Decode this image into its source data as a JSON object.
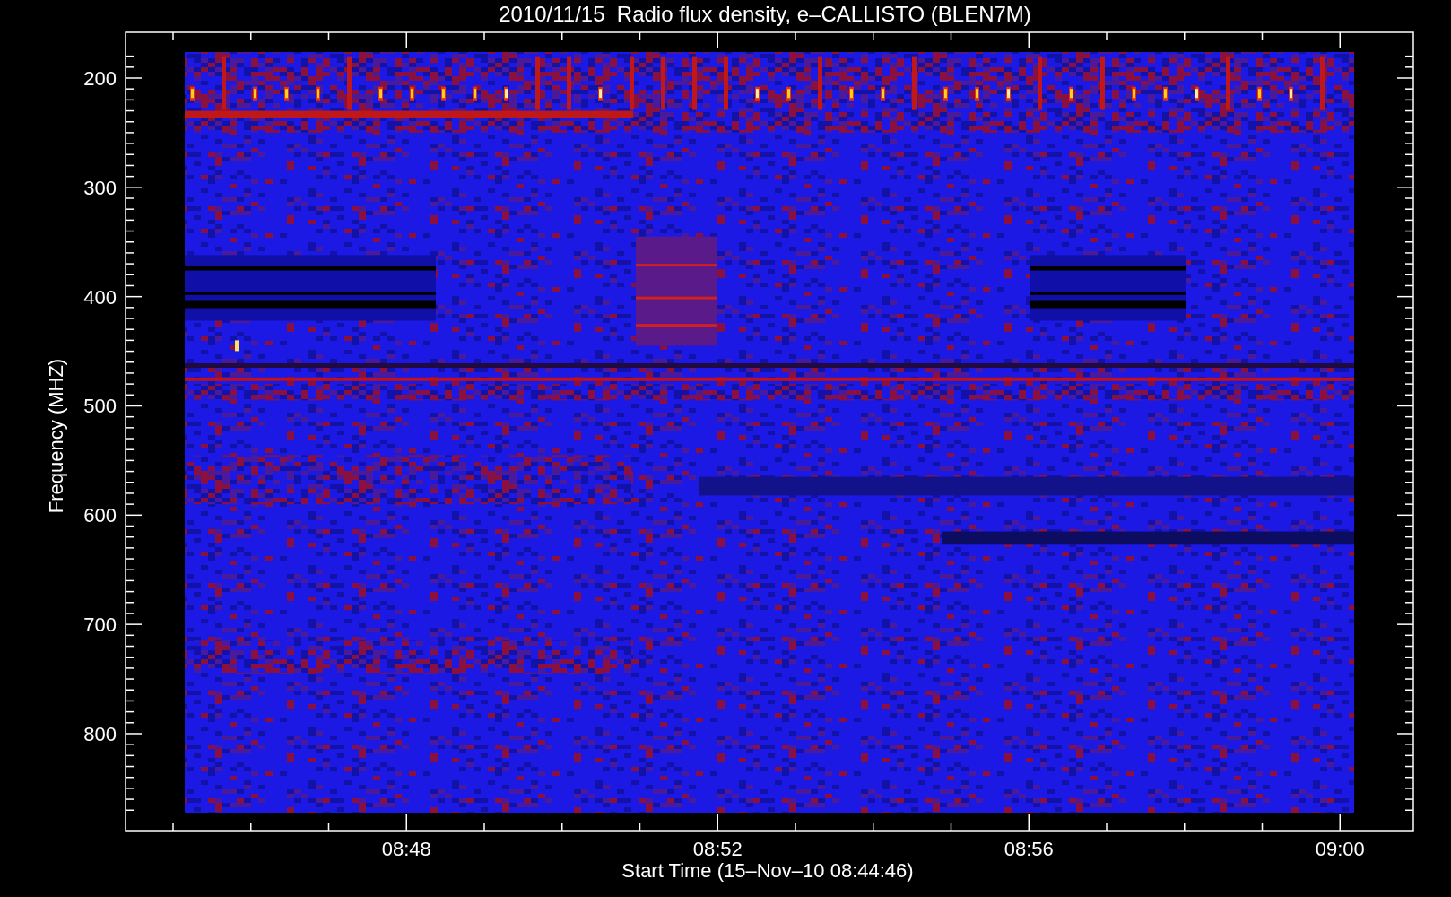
{
  "title": "2010/11/15  Radio flux density, e–CALLISTO (BLEN7M)",
  "y_axis": {
    "label": "Frequency (MHZ)",
    "ticks": [
      "200",
      "300",
      "400",
      "500",
      "600",
      "700",
      "800"
    ]
  },
  "x_axis": {
    "label": "Start Time (15–Nov–10 08:44:46)",
    "ticks": [
      "08:48",
      "08:52",
      "08:56",
      "09:00"
    ]
  }
}
